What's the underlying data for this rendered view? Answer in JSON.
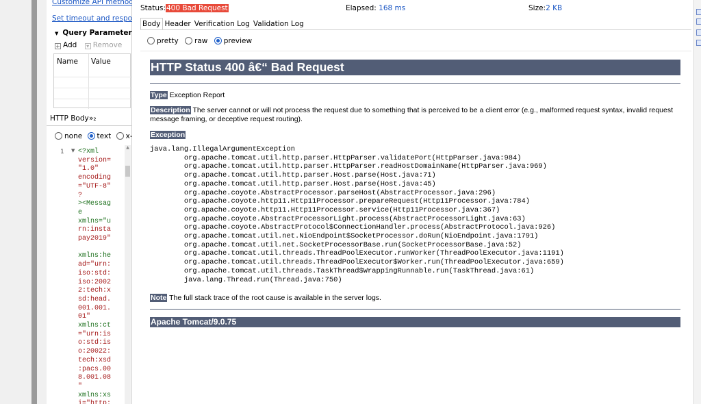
{
  "request_panel": {
    "link_customize": "Customize API methods",
    "link_timeout": "Set timeout and response",
    "query_params": {
      "title": "Query Parameters",
      "add_label": "Add",
      "remove_label": "Remove",
      "col_name": "Name",
      "col_value": "Value"
    },
    "body_tabs": {
      "http_body": "HTTP Body",
      "more": "»₂"
    },
    "body_type": {
      "none": "none",
      "text": "text",
      "xw": "x-w",
      "selected": "text"
    },
    "code": {
      "line_number": "1",
      "lines": [
        "<?xml",
        "version=",
        "\"1.0\"",
        "encoding",
        "=\"UTF-8\"",
        "?",
        "><Messag",
        "e",
        "xmlns=\"u",
        "rn:insta",
        "pay2019\"",
        "",
        "xmlns:he",
        "ad=\"urn:",
        "iso:std:",
        "iso:2002",
        "2:tech:x",
        "sd:head.",
        "001.001.",
        "01\"",
        "xmlns:ct",
        "=\"urn:is",
        "o:std:is",
        "o:20022:",
        "tech:xsd",
        ":pacs.00",
        "8.001.08",
        "\"",
        "xmlns:xs",
        "i=\"http:"
      ]
    }
  },
  "response": {
    "status_label": "Status:",
    "status_value": "400 Bad Request",
    "elapsed_label": "Elapsed:",
    "elapsed_value": "168 ms",
    "size_label": "Size:",
    "size_value": "2 KB",
    "tabs": [
      "Body",
      "Header",
      "Verification Log",
      "Validation Log"
    ],
    "active_tab": "Body",
    "view_modes": {
      "pretty": "pretty",
      "raw": "raw",
      "preview": "preview",
      "selected": "preview"
    },
    "page": {
      "title": "HTTP Status 400 â€“ Bad Request",
      "type_label": "Type",
      "type_text": " Exception Report",
      "desc_label": "Description",
      "desc_text": " The server cannot or will not process the request due to something that is perceived to be a client error (e.g., malformed request syntax, invalid request message framing, or deceptive request routing).",
      "exception_label": "Exception",
      "stack_trace": "java.lang.IllegalArgumentException\n\torg.apache.tomcat.util.http.parser.HttpParser.validatePort(HttpParser.java:984)\n\torg.apache.tomcat.util.http.parser.HttpParser.readHostDomainName(HttpParser.java:969)\n\torg.apache.tomcat.util.http.parser.Host.parse(Host.java:71)\n\torg.apache.tomcat.util.http.parser.Host.parse(Host.java:45)\n\torg.apache.coyote.AbstractProcessor.parseHost(AbstractProcessor.java:296)\n\torg.apache.coyote.http11.Http11Processor.prepareRequest(Http11Processor.java:784)\n\torg.apache.coyote.http11.Http11Processor.service(Http11Processor.java:367)\n\torg.apache.coyote.AbstractProcessorLight.process(AbstractProcessorLight.java:63)\n\torg.apache.coyote.AbstractProtocol$ConnectionHandler.process(AbstractProtocol.java:926)\n\torg.apache.tomcat.util.net.NioEndpoint$SocketProcessor.doRun(NioEndpoint.java:1791)\n\torg.apache.tomcat.util.net.SocketProcessorBase.run(SocketProcessorBase.java:52)\n\torg.apache.tomcat.util.threads.ThreadPoolExecutor.runWorker(ThreadPoolExecutor.java:1191)\n\torg.apache.tomcat.util.threads.ThreadPoolExecutor$Worker.run(ThreadPoolExecutor.java:659)\n\torg.apache.tomcat.util.threads.TaskThread$WrappingRunnable.run(TaskThread.java:61)\n\tjava.lang.Thread.run(Thread.java:750)",
      "note_label": "Note",
      "note_text": " The full stack trace of the root cause is available in the server logs.",
      "footer": "Apache Tomcat/9.0.75"
    }
  },
  "colors": {
    "tomcat_header": "#525d76",
    "status_error": "#e84a3a",
    "link": "#1a56c4",
    "radio_selected": "#1e5fc9"
  }
}
